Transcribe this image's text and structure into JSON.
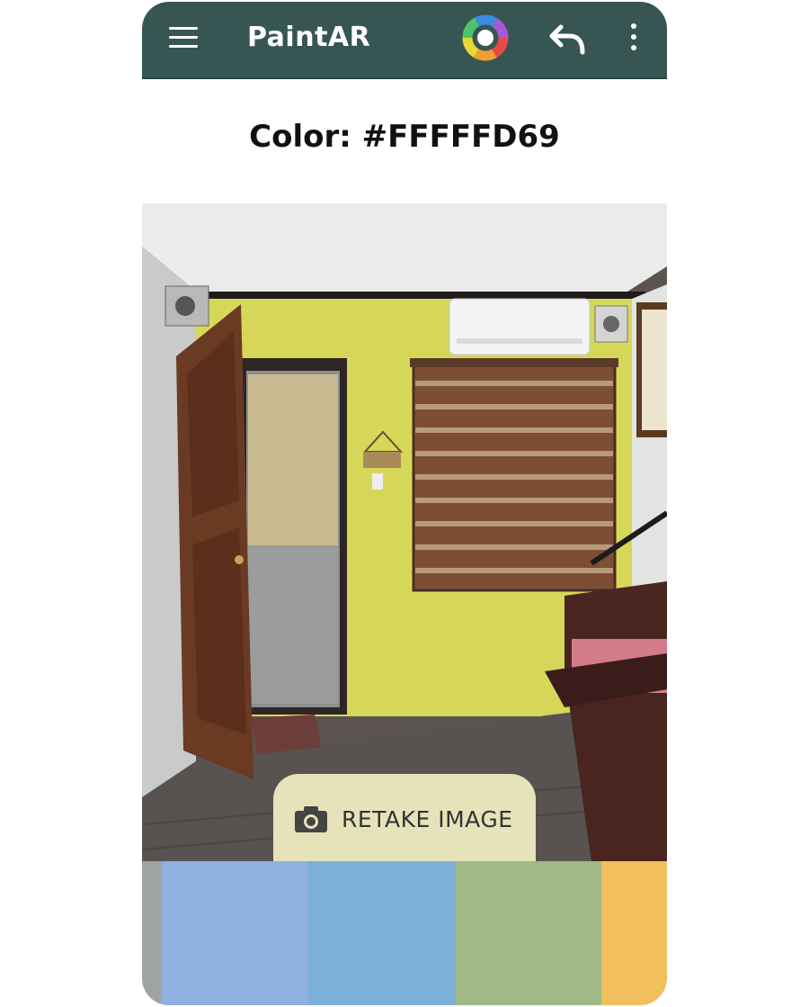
{
  "app_bar": {
    "title": "PaintAR",
    "icons": [
      "menu-icon",
      "color-wheel-icon",
      "undo-icon",
      "more-vert-icon"
    ],
    "background": "#375653"
  },
  "color_heading": "Color: #FFFFFD69",
  "photo": {
    "wall_color": "#d6d759"
  },
  "retake_button": {
    "label": "RETAKE IMAGE",
    "icon": "camera-icon"
  },
  "swatches": [
    {
      "color": "#9fa3a3"
    },
    {
      "color": "#8fb0e0"
    },
    {
      "color": "#7bb0d9"
    },
    {
      "color": "#a2b988"
    },
    {
      "color": "#f1c05c"
    }
  ]
}
